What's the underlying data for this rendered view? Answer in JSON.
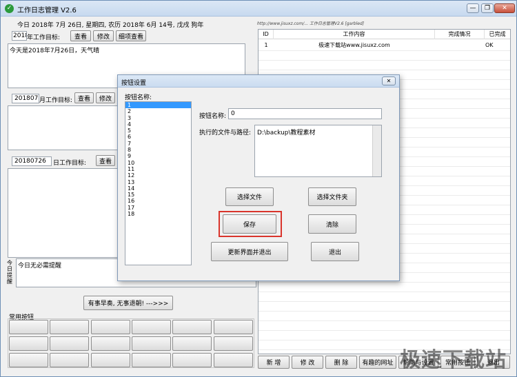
{
  "app": {
    "title": "工作日志管理 V2.6",
    "icon": "check-circle-icon"
  },
  "window_controls": {
    "minimize": "—",
    "restore": "❐",
    "close": "✕"
  },
  "date_line": "今日 2018年 7月 26日, 星期四, 农历 2018年 6月 14号, 戊戌 狗年",
  "year_goal": {
    "value": "2018",
    "label": "年工作目标:",
    "view": "查看",
    "edit": "修改",
    "detail": "细项查看",
    "text": "今天是2018年7月26日，天气晴"
  },
  "month_goal": {
    "value": "201807",
    "label": "月工作目标:",
    "view": "查看",
    "edit": "修改"
  },
  "day_goal": {
    "value": "20180726",
    "label": "日工作目标:",
    "view": "查看"
  },
  "reminder": {
    "side_label": "今日提醒",
    "text": "今日无必需提醒"
  },
  "motto_button": "有事早奏, 无事退朝! --->>>",
  "common_buttons": {
    "label": "常用按钮"
  },
  "url_strip": "http://www.jisuxz.com/... 工作日志管理V2.6  [garbled]",
  "table": {
    "headers": [
      "ID",
      "工作内容",
      "完成情况",
      "已完成"
    ],
    "rows": [
      [
        "1",
        "极速下载站www.jisuxz.com",
        "",
        "OK"
      ]
    ]
  },
  "bottom_buttons": [
    "新 增",
    "修 改",
    "删 除",
    "有趣的网址",
    "帮助与设置",
    "常用按钮",
    "退出"
  ],
  "dialog": {
    "title": "按钮设置",
    "close": "✕",
    "list_label": "按钮名称:",
    "items": [
      "1",
      "2",
      "3",
      "4",
      "5",
      "6",
      "7",
      "8",
      "9",
      "10",
      "11",
      "12",
      "13",
      "14",
      "15",
      "16",
      "17",
      "18"
    ],
    "name_label": "按钮名称:",
    "name_value": "0",
    "path_label": "执行的文件与路径:",
    "path_value": "D:\\backup\\教程素材",
    "btn_select_file": "选择文件",
    "btn_select_folder": "选择文件夹",
    "btn_save": "保存",
    "btn_clear": "清除",
    "btn_update_exit": "更新界面并退出",
    "btn_exit": "退出"
  },
  "watermark": "极速下载站",
  "highlight_color": "#d9342b"
}
